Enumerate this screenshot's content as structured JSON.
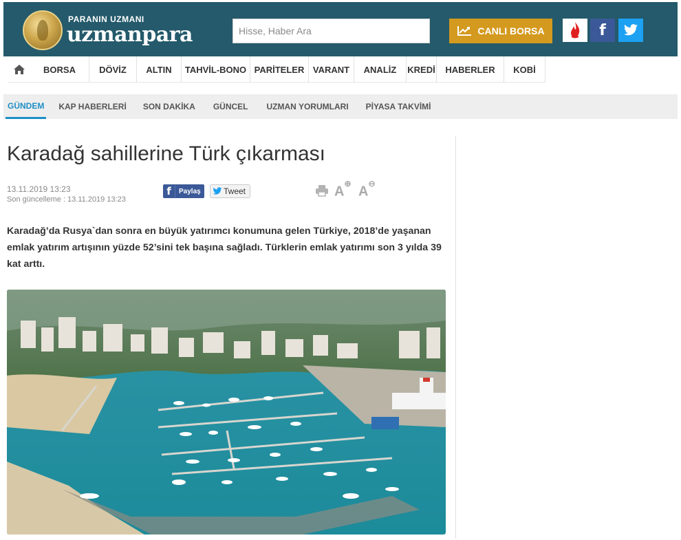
{
  "header": {
    "logo_small": "PARANIN UZMANI",
    "logo_big": "uzmanpara",
    "search_placeholder": "Hisse, Haber Ara",
    "live_button": "CANLI BORSA",
    "facebook_letter": "f",
    "colors": {
      "header_bg": "#245a6b",
      "live_button_bg": "#d49a1f",
      "facebook": "#3b5998",
      "twitter": "#1da1f2"
    }
  },
  "main_nav": [
    {
      "label": "BORSA"
    },
    {
      "label": "DÖVİZ"
    },
    {
      "label": "ALTIN"
    },
    {
      "label": "TAHVİL-BONO"
    },
    {
      "label": "PARİTELER"
    },
    {
      "label": "VARANT"
    },
    {
      "label": "ANALİZ"
    },
    {
      "label": "KREDİ"
    },
    {
      "label": "HABERLER"
    },
    {
      "label": "KOBİ"
    }
  ],
  "sub_nav": [
    {
      "label": "GÜNDEM",
      "active": true
    },
    {
      "label": "KAP HABERLERİ"
    },
    {
      "label": "SON DAKİKA"
    },
    {
      "label": "GÜNCEL"
    },
    {
      "label": "UZMAN YORUMLARI"
    },
    {
      "label": "PİYASA TAKVİMİ"
    }
  ],
  "article": {
    "title": "Karadağ sahillerine Türk çıkarması",
    "date": "13.11.2019 13:23",
    "updated": "Son güncelleme : 13.11.2019 13:23",
    "share_facebook": "Paylaş",
    "share_twitter": "Tweet",
    "font_increase": "A",
    "font_decrease": "A",
    "lead": "Karadağ’da Rusya`dan sonra en büyük yatırımcı konumuna gelen Türkiye, 2018’de yaşanan emlak yatırım artışının yüzde 52’sini tek başına sağladı. Türklerin emlak yatırımı son 3 yılda 39 kat arttı.",
    "image_subject": "marina-aerial-photo"
  }
}
